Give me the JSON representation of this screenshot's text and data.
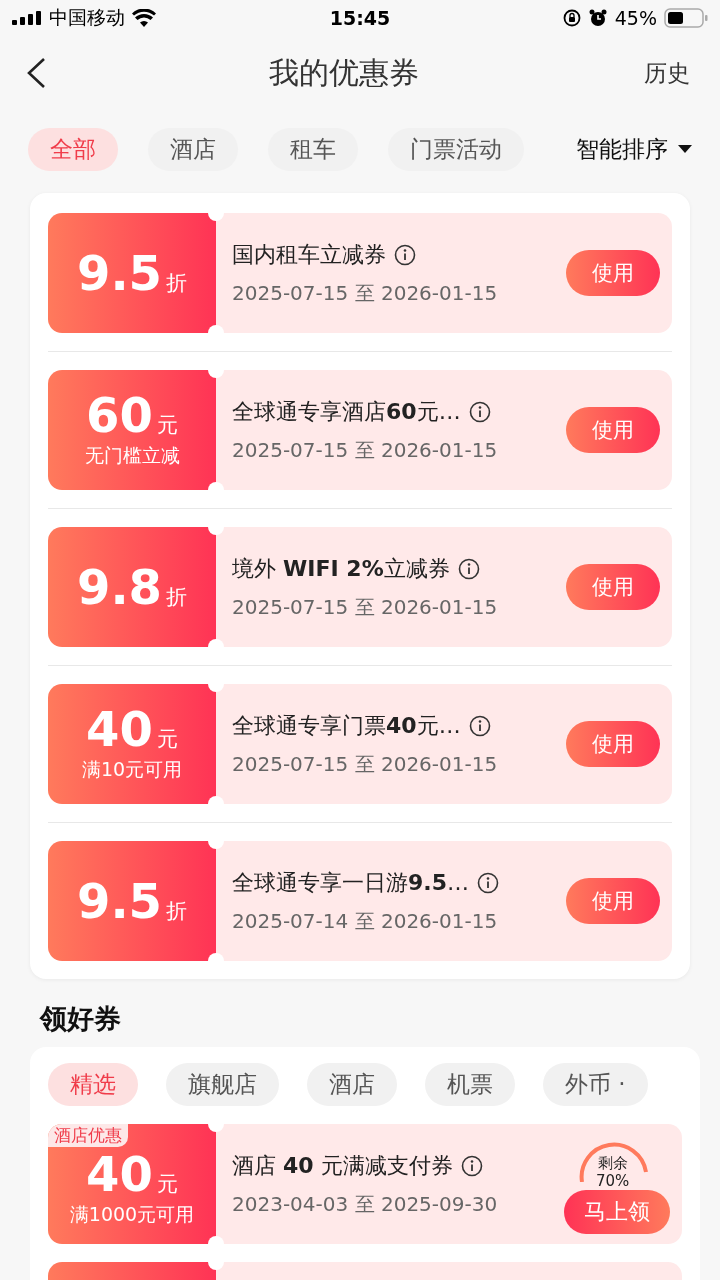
{
  "status_bar": {
    "carrier": "中国移动",
    "time": "15:45",
    "battery": "45%"
  },
  "nav": {
    "title": "我的优惠券",
    "action": "历史"
  },
  "filters": [
    {
      "label": "全部",
      "selected": true
    },
    {
      "label": "酒店",
      "selected": false
    },
    {
      "label": "租车",
      "selected": false
    },
    {
      "label": "门票活动",
      "selected": false
    }
  ],
  "sort": {
    "label": "智能排序"
  },
  "my_coupons": [
    {
      "amount": "9.5",
      "unit": "折",
      "title": "国内租车立减券",
      "validity": "2025-07-15 至 2026-01-15",
      "button": "使用"
    },
    {
      "amount": "60",
      "unit": "元",
      "condition": "无门槛立减",
      "title": "全球通专享酒店**60**元…",
      "validity": "2025-07-15 至 2026-01-15",
      "button": "使用"
    },
    {
      "amount": "9.8",
      "unit": "折",
      "title": "境外 **WIFI 2%**立减券",
      "validity": "2025-07-15 至 2026-01-15",
      "button": "使用"
    },
    {
      "amount": "40",
      "unit": "元",
      "condition": "满10元可用",
      "title": "全球通专享门票**40**元…",
      "validity": "2025-07-15 至 2026-01-15",
      "button": "使用"
    },
    {
      "amount": "9.5",
      "unit": "折",
      "title": "全球通专享一日游**9.5**…",
      "validity": "2025-07-14 至 2026-01-15",
      "button": "使用"
    }
  ],
  "section_title": "领好券",
  "claim_tabs": [
    {
      "label": "精选",
      "selected": true
    },
    {
      "label": "旗舰店",
      "selected": false
    },
    {
      "label": "酒店",
      "selected": false
    },
    {
      "label": "机票",
      "selected": false
    },
    {
      "label": "外币 ·",
      "selected": false
    }
  ],
  "claim_coupons": [
    {
      "tag": "酒店优惠",
      "amount": "40",
      "unit": "元",
      "condition": "满1000元可用",
      "title": "酒店 **40** 元满减支付券",
      "validity": "2023-04-03 至 2025-09-30",
      "remaining_label": "剩余",
      "remaining": "70%",
      "button": "马上领"
    }
  ]
}
